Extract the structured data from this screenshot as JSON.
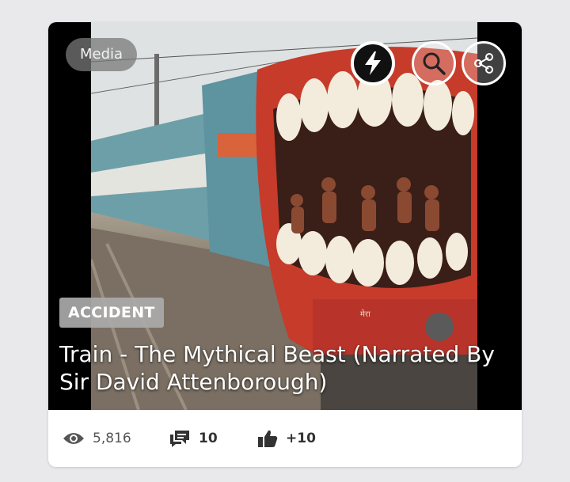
{
  "media_tag": "Media",
  "category": "ACCIDENT",
  "title": "Train - The Mythical Beast (Narrated By Sir David Attenborough)",
  "image_text": "मेरा",
  "stats": {
    "views": "5,816",
    "comments": "10",
    "likes": "+10"
  },
  "icons": {
    "bolt": "lightning-bolt-icon",
    "search": "search-icon",
    "share": "share-icon",
    "views": "eye-icon",
    "comments": "comments-icon",
    "likes": "thumbs-up-icon"
  },
  "colors": {
    "page_bg": "#e9e9ec",
    "card_bg": "#ffffff",
    "badge_bg": "#aaaaaa"
  }
}
